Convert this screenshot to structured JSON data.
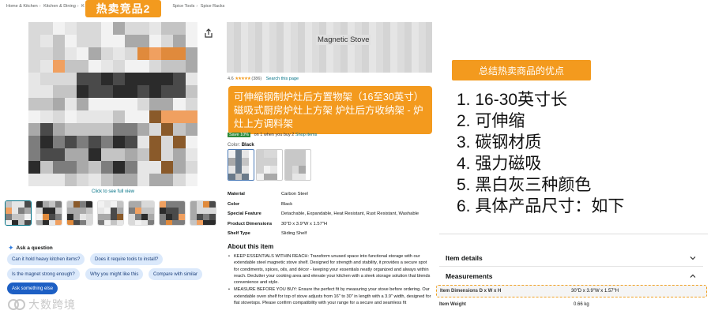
{
  "breadcrumb": [
    "Home & Kitchen",
    "Kitchen & Dining",
    "K",
    "Spice Tools",
    "Spice Racks"
  ],
  "top_tag": "热卖竞品2",
  "gallery": {
    "see_full_view": "Click to see full view"
  },
  "product": {
    "title_visible": "Magnetic Stove",
    "rating_value": "4.6",
    "rating_count": "(386)",
    "search_page_link": "Search this page",
    "save_badge": "Save 10%",
    "save_text": "on 1 when you buy 2",
    "shop_items_link": "Shop items",
    "color_label": "Color:",
    "color_value": "Black"
  },
  "title_callout": "可伸缩钢制炉灶后方置物架（16至30英寸）磁吸式厨房炉灶上方架 炉灶后方收纳架 - 炉灶上方调料架",
  "specs": [
    {
      "key": "Material",
      "value": "Carbon Steel"
    },
    {
      "key": "Color",
      "value": "Black"
    },
    {
      "key": "Special Feature",
      "value": "Detachable, Expandable, Heat Resistant, Rust Resistant, Washable"
    },
    {
      "key": "Product Dimensions",
      "value": "30\"D x 3.9\"W x 1.57\"H"
    },
    {
      "key": "Shelf Type",
      "value": "Sliding Shelf"
    }
  ],
  "about": {
    "title": "About this item",
    "bullets": [
      "KEEP ESSENTIALS WITHIN REACH: Transform unused space into functional storage with our extendable steel magnetic stove shelf. Designed for strength and stability, it provides a secure spot for condiments, spices, oils, and décor - keeping your essentials neatly organized and always within reach. Declutter your cooking area and elevate your kitchen with a sleek storage solution that blends convenience and style.",
      "MEASURE BEFORE YOU BUY: Ensure the perfect fit by measuring your stove before ordering. Our extendable oven shelf for top of stove adjusts from 16\" to 30\" in length with a 3.9\" width, designed for flat stovetops. Please confirm compatibility with your range for a secure and seamless fit"
    ]
  },
  "ask": {
    "title": "Ask a question",
    "chips": [
      "Can it hold heavy kitchen items?",
      "Does it require tools to install?",
      "Is the magnet strong enough?",
      "Why you might like this",
      "Compare with similar",
      "Ask something else"
    ]
  },
  "watermark": "大数跨境",
  "summary": {
    "title": "总结热卖商品的优点",
    "items": [
      "1. 16-30英寸长",
      "2. 可伸缩",
      "3. 碳钢材质",
      "4. 强力磁吸",
      "5. 黑白灰三种颜色",
      "6. 具体产品尺寸：如下"
    ]
  },
  "details": {
    "item_details": "Item details",
    "measurements": "Measurements",
    "rows": [
      {
        "key": "Item Dimensions D x W x H",
        "value": "30\"D x 3.9\"W x 1.57\"H"
      },
      {
        "key": "Item Weight",
        "value": "0.66 kg"
      }
    ]
  },
  "colors": {
    "accent_orange": "#f39a1e",
    "link": "#007185",
    "chip_bg": "#dbe9fb",
    "chip_dark": "#1d5fc4"
  }
}
